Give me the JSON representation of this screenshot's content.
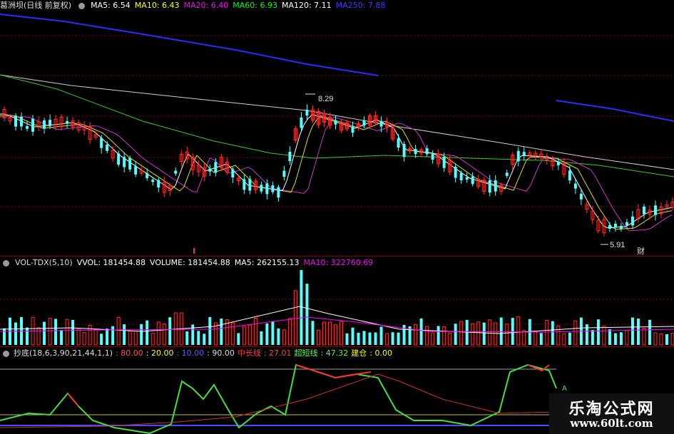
{
  "main_panel": {
    "title": "葛洲坝(日线 前复权)",
    "ma": [
      {
        "label": "MA5: 6.54",
        "color": "#ffffff"
      },
      {
        "label": "MA10: 6.43",
        "color": "#ffff00"
      },
      {
        "label": "MA20: 6.40",
        "color": "#ff00ff"
      },
      {
        "label": "MA60: 6.93",
        "color": "#00ff00"
      },
      {
        "label": "MA120: 7.11",
        "color": "#ffffff"
      },
      {
        "label": "MA250: 7.88",
        "color": "#2222ff"
      }
    ],
    "high_label": "8.29",
    "low_label": "5.91",
    "fin_label": "财"
  },
  "vol_panel": {
    "name": "VOL-TDX(5,10)",
    "vvol": "VVOL: 181454.88",
    "volume": "VOLUME: 181454.88",
    "ma5": "MA5: 262155.13",
    "ma10": "MA10: 322760.69"
  },
  "ind_panel": {
    "name": "抄底(18,6,3,90,21,44,1,1)",
    "v1": ": 80.00",
    "v2": ": 20.00",
    "v3": ": 10.00",
    "v4": ": 90.00",
    "zcx_label": "中长线",
    "zcx_val": ": 27.01",
    "cmx_label": "超短线",
    "cmx_val": ": 47.32",
    "jc_label": "建仓",
    "jc_val": ": 0.00"
  },
  "watermark": {
    "title": "乐淘公式网",
    "url": "www.60lt.com"
  },
  "colors": {
    "up": "#ff3030",
    "down": "#54ffff",
    "grid": "#8a0000"
  }
}
